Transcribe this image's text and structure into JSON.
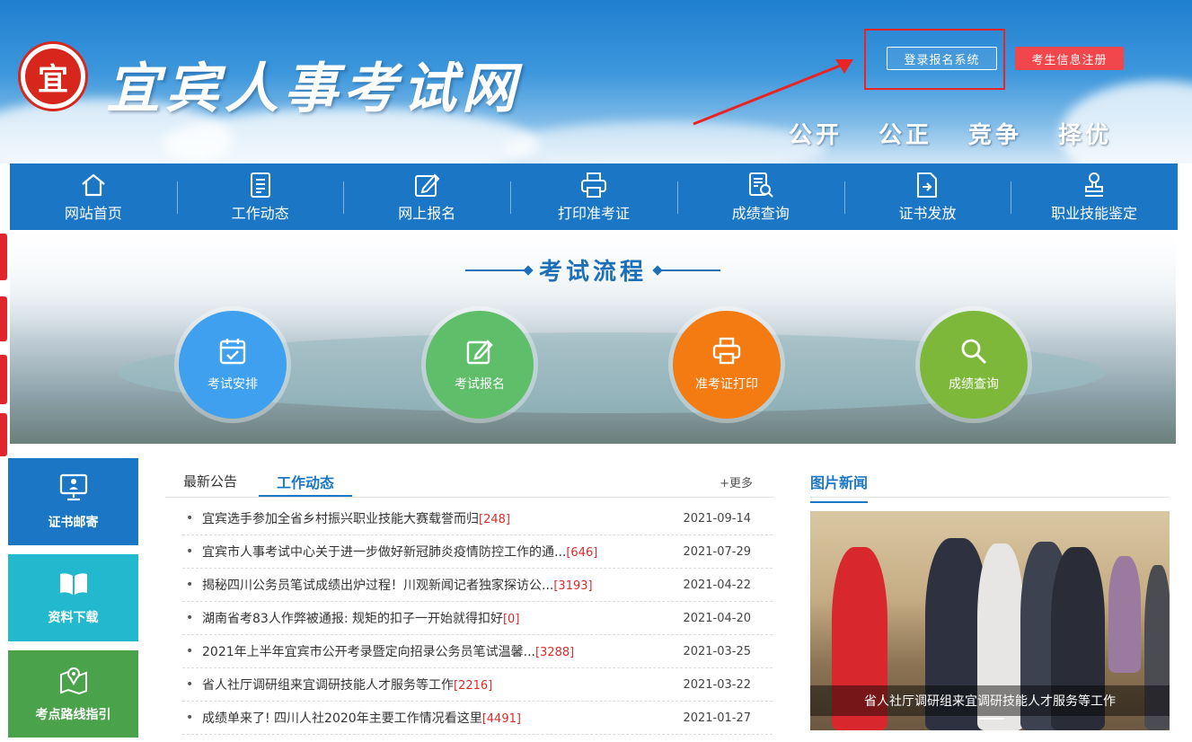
{
  "header": {
    "emblem_char": "宜",
    "site_title": "宜宾人事考试网",
    "login_button": "登录报名系统",
    "register_button": "考生信息注册",
    "slogans": [
      "公开",
      "公正",
      "竞争",
      "择优"
    ]
  },
  "nav": [
    {
      "label": "网站首页",
      "icon": "home-icon"
    },
    {
      "label": "工作动态",
      "icon": "document-icon"
    },
    {
      "label": "网上报名",
      "icon": "edit-icon"
    },
    {
      "label": "打印准考证",
      "icon": "printer-icon"
    },
    {
      "label": "成绩查询",
      "icon": "search-document-icon"
    },
    {
      "label": "证书发放",
      "icon": "certificate-icon"
    },
    {
      "label": "职业技能鉴定",
      "icon": "stamp-icon"
    }
  ],
  "flow": {
    "title": "考试流程",
    "steps": [
      {
        "label": "考试安排",
        "color": "#3ea0ee"
      },
      {
        "label": "考试报名",
        "color": "#5fbe6a"
      },
      {
        "label": "准考证打印",
        "color": "#f47b12"
      },
      {
        "label": "成绩查询",
        "color": "#7db83a"
      }
    ]
  },
  "side_blocks": [
    {
      "label": "证书邮寄",
      "color": "#1b77c6",
      "icon": "monitor-user-icon"
    },
    {
      "label": "资料下载",
      "color": "#22b9cf",
      "icon": "book-icon"
    },
    {
      "label": "考点路线指引",
      "color": "#4aa34a",
      "icon": "map-pin-icon"
    }
  ],
  "news": {
    "tab_latest": "最新公告",
    "tab_work": "工作动态",
    "more": "+更多",
    "items": [
      {
        "title": "宜宾选手参加全省乡村振兴职业技能大赛载誉而归",
        "count": "[248]",
        "date": "2021-09-14"
      },
      {
        "title": "宜宾市人事考试中心关于进一步做好新冠肺炎疫情防控工作的通...",
        "count": "[646]",
        "date": "2021-07-29"
      },
      {
        "title": "揭秘四川公务员笔试成绩出炉过程！川观新闻记者独家探访公...",
        "count": "[3193]",
        "date": "2021-04-22"
      },
      {
        "title": "湖南省考83人作弊被通报: 规矩的扣子一开始就得扣好",
        "count": "[0]",
        "date": "2021-04-20"
      },
      {
        "title": "2021年上半年宜宾市公开考录暨定向招录公务员笔试温馨...",
        "count": "[3288]",
        "date": "2021-03-25"
      },
      {
        "title": "省人社厅调研组来宜调研技能人才服务等工作",
        "count": "[2216]",
        "date": "2021-03-22"
      },
      {
        "title": "成绩单来了! 四川人社2020年主要工作情况看这里",
        "count": "[4491]",
        "date": "2021-01-27"
      }
    ]
  },
  "picture_news": {
    "title": "图片新闻",
    "caption": "省人社厅调研组来宜调研技能人才服务等工作"
  }
}
